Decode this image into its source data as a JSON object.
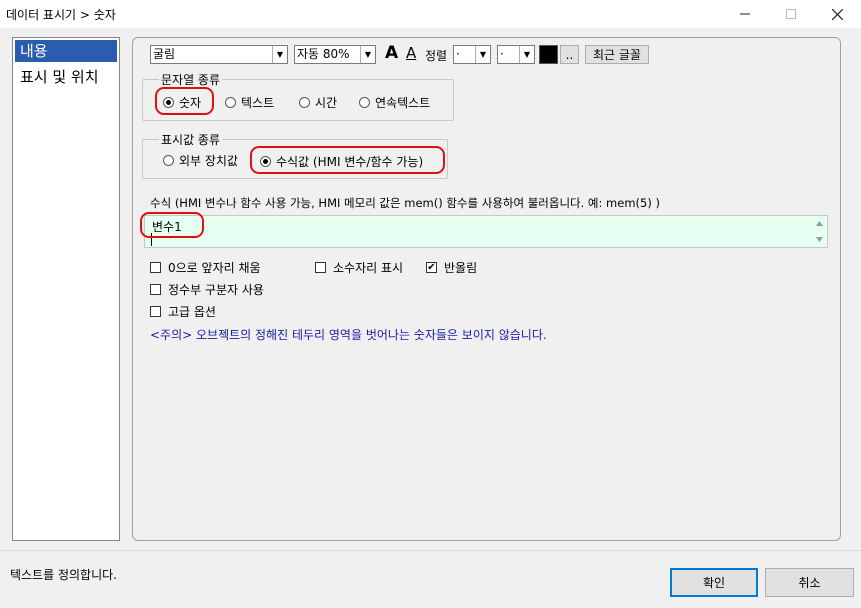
{
  "window": {
    "title": "데이터 표시기 > 숫자"
  },
  "sidebar": {
    "items": [
      {
        "label": "내용",
        "selected": true
      },
      {
        "label": "표시 및 위치",
        "selected": false
      }
    ]
  },
  "toolbar": {
    "font_name": "굴림",
    "font_size": "자동 80%",
    "font_grow_label": "A",
    "font_shrink_label": "A",
    "align_label": "정렬",
    "align_h_value": "·",
    "align_v_value": "·",
    "color_value": "#000000",
    "color_more_label": "..",
    "recent_font_label": "최근 글꼴"
  },
  "string_type": {
    "legend": "문자열 종류",
    "options": [
      {
        "label": "숫자",
        "checked": true
      },
      {
        "label": "텍스트",
        "checked": false
      },
      {
        "label": "시간",
        "checked": false
      },
      {
        "label": "연속텍스트",
        "checked": false
      }
    ]
  },
  "value_type": {
    "legend": "표시값 종류",
    "options": [
      {
        "label": "외부 장치값",
        "checked": false
      },
      {
        "label": "수식값 (HMI 변수/함수 가능)",
        "checked": true
      }
    ]
  },
  "formula": {
    "label": "수식 (HMI 변수나 함수 사용 가능, HMI 메모리 값은 mem() 함수를 사용하여 불러옵니다. 예: mem(5) )",
    "value": "변수1"
  },
  "options": {
    "zero_fill": {
      "label": "0으로 앞자리 채움",
      "checked": false
    },
    "decimal_show": {
      "label": "소수자리 표시",
      "checked": false
    },
    "round": {
      "label": "반올림",
      "checked": true
    },
    "int_separator": {
      "label": "정수부 구분자 사용",
      "checked": false
    },
    "advanced": {
      "label": "고급 옵션",
      "checked": false
    }
  },
  "note": "<주의> 오브젝트의 정해진 테두리 영역을 벗어나는 숫자들은 보이지 않습니다.",
  "status": "텍스트를 정의합니다.",
  "buttons": {
    "ok": "확인",
    "cancel": "취소"
  },
  "colors": {
    "accent": "#2a5db0",
    "highlight": "#e01010",
    "formula_bg": "#e5fff0",
    "note_text": "#1a1aa8"
  }
}
